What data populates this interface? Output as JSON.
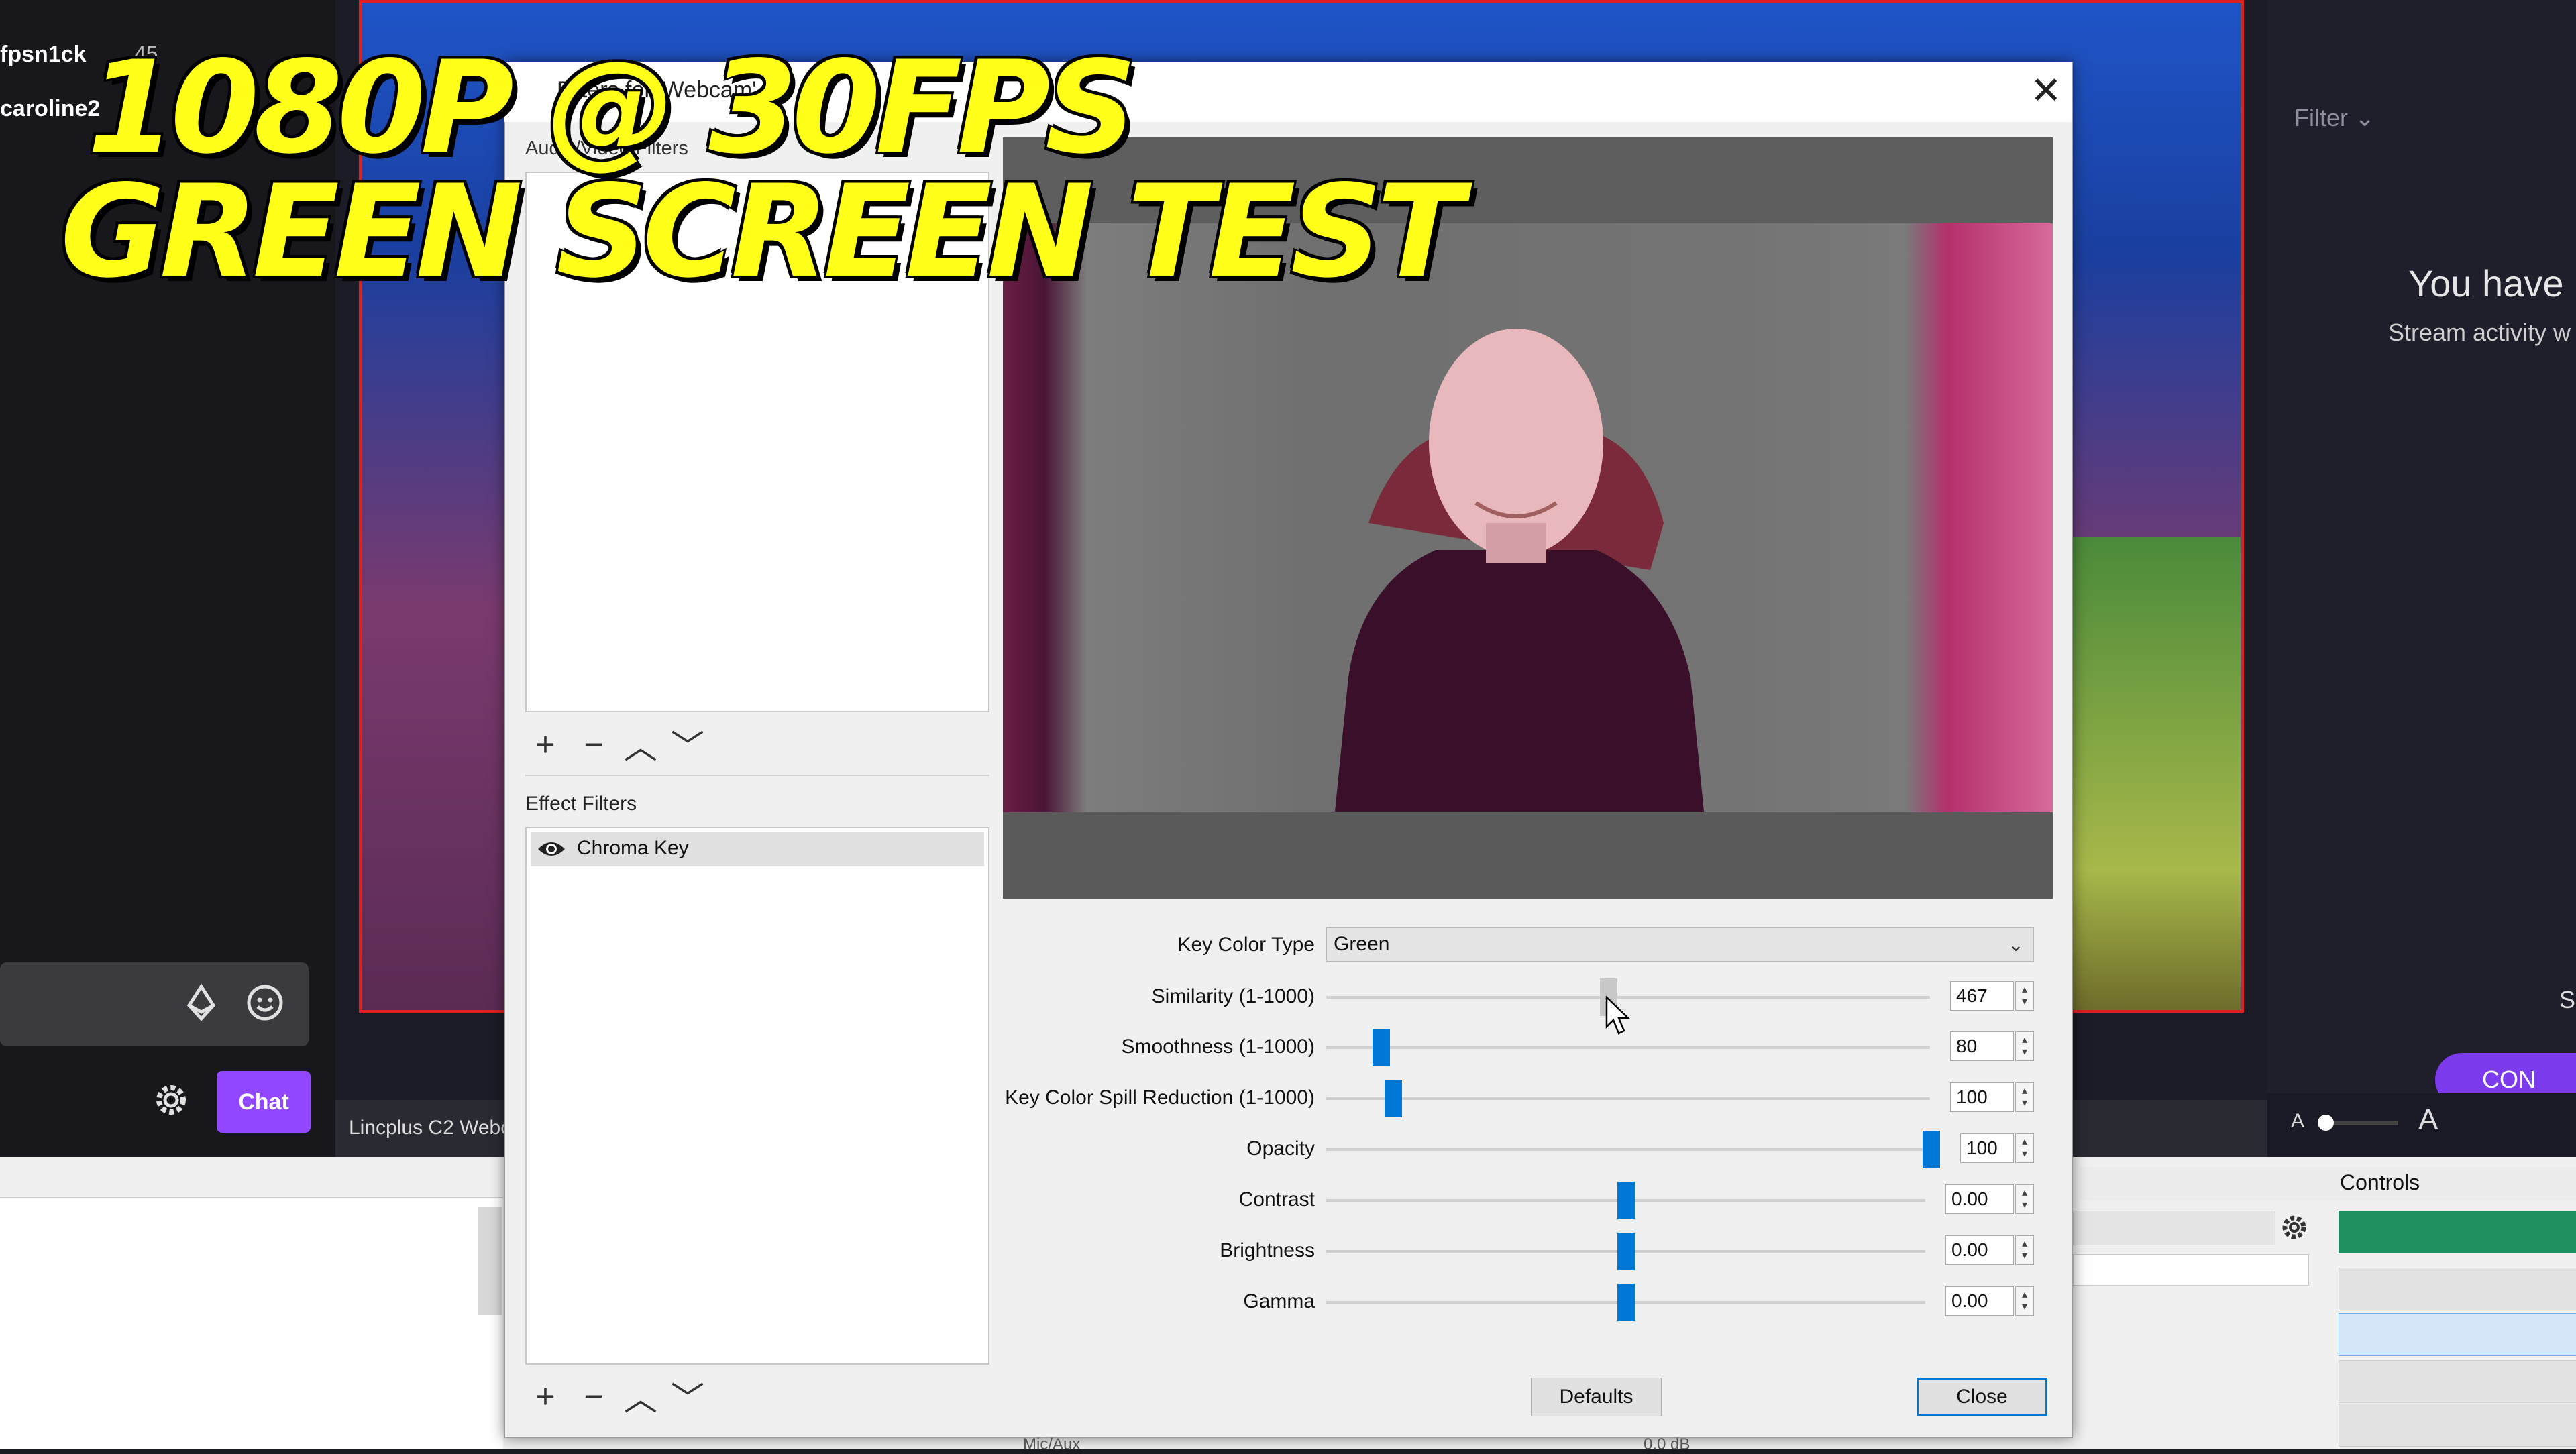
{
  "overlay": {
    "line1": "1080P @ 30FPS",
    "line2": "GREEN SCREEN TEST"
  },
  "chat": {
    "user1": "fpsn1ck",
    "user1_count": "45",
    "user2": "caroline2",
    "chat_button": "Chat"
  },
  "preview": {
    "source_label": "Lincplus C2 Webca"
  },
  "right_panel": {
    "filter_label": "Filter",
    "empty_title": "You have",
    "empty_subtitle": "Stream activity w",
    "letter_s": "S",
    "connect_label": "CON",
    "font_small": "A",
    "font_large": "A"
  },
  "dock": {
    "controls_label": "Controls",
    "mic_label": "Mic/Aux",
    "mic_db": "0.0 dB"
  },
  "dialog": {
    "title": "Filters for 'Webcam'",
    "close_glyph": "✕",
    "av_filters_label": "Audio/Video Filters",
    "effect_filters_label": "Effect Filters",
    "effect_items": [
      "Chroma Key"
    ],
    "toolbar": {
      "add": "+",
      "remove": "−",
      "up": "︿",
      "down": "﹀"
    },
    "properties": {
      "key_color_type": {
        "label": "Key Color Type",
        "value": "Green"
      },
      "similarity": {
        "label": "Similarity (1-1000)",
        "value": "467",
        "min": 1,
        "max": 1000,
        "level": 467
      },
      "smoothness": {
        "label": "Smoothness (1-1000)",
        "value": "80",
        "min": 1,
        "max": 1000,
        "level": 80
      },
      "spill": {
        "label": "Key Color Spill Reduction (1-1000)",
        "value": "100",
        "min": 1,
        "max": 1000,
        "level": 100
      },
      "opacity": {
        "label": "Opacity",
        "value": "100",
        "min": 0,
        "max": 100,
        "level": 100
      },
      "contrast": {
        "label": "Contrast",
        "value": "0.00",
        "min": -1,
        "max": 1,
        "level": 0
      },
      "brightness": {
        "label": "Brightness",
        "value": "0.00",
        "min": -1,
        "max": 1,
        "level": 0
      },
      "gamma": {
        "label": "Gamma",
        "value": "0.00",
        "min": -1,
        "max": 1,
        "level": 0
      }
    },
    "defaults_label": "Defaults",
    "close_label": "Close"
  },
  "colors": {
    "accent": "#0078d7",
    "twitch_purple": "#9147ff",
    "overlay_yellow": "#ffff1a",
    "start_streaming_green": "#1f8f5f"
  }
}
